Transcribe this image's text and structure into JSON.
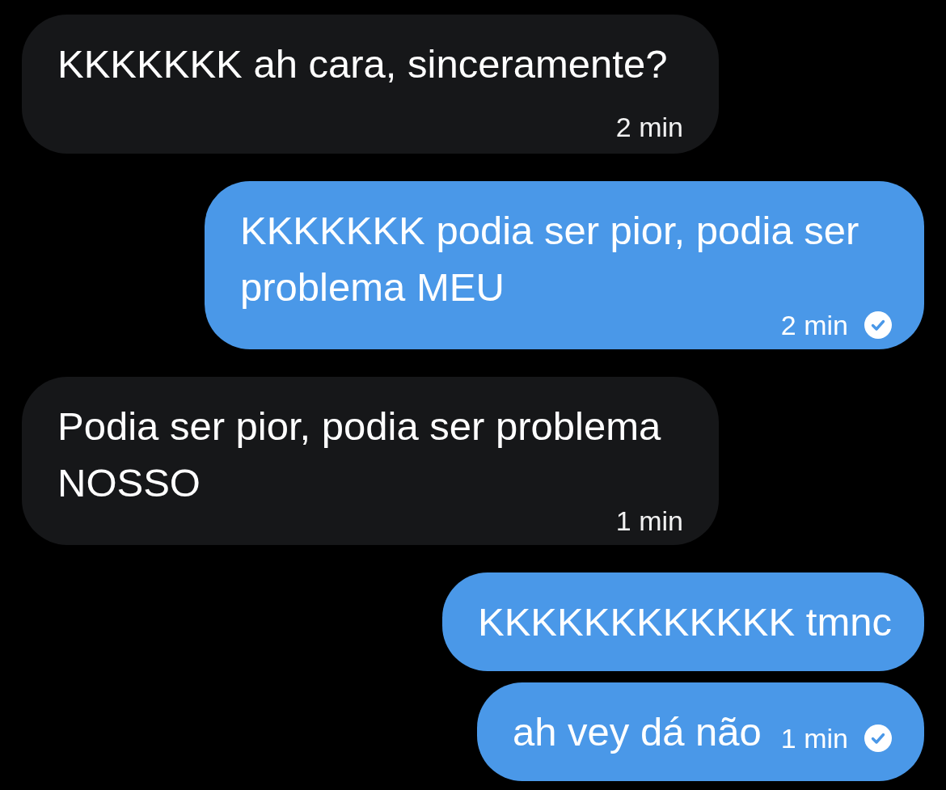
{
  "messages": [
    {
      "kind": "received",
      "text": "KKKKKKK ah cara, sinceramente?",
      "time": "2 min"
    },
    {
      "kind": "sent",
      "text": "KKKKKKK podia ser pior, podia ser problema MEU",
      "time": "2 min",
      "delivered": true
    },
    {
      "kind": "received",
      "text": "Podia ser pior, podia ser problema NOSSO",
      "time": "1 min"
    },
    {
      "kind": "sent",
      "text": "KKKKKKKKKKKK tmnc"
    },
    {
      "kind": "sent",
      "text": "ah vey dá não",
      "time": "1 min",
      "delivered": true
    }
  ]
}
